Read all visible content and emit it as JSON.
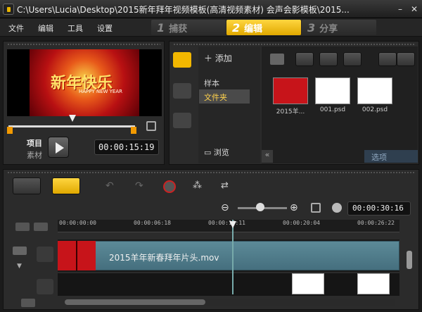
{
  "window": {
    "title": "C:\\Users\\Lucia\\Desktop\\2015新年拜年视频模板(高清视频素材) 会声会影模板\\2015...",
    "minimize": "–",
    "close": "✕"
  },
  "menu": [
    "文件",
    "编辑",
    "工具",
    "设置"
  ],
  "steps": [
    {
      "num": "1",
      "label": "捕获"
    },
    {
      "num": "2",
      "label": "编辑"
    },
    {
      "num": "3",
      "label": "分享"
    }
  ],
  "preview": {
    "title_text": "新年快乐",
    "sub_text": "HAPPY NEW YEAR",
    "project_label": "项目",
    "clip_label": "素材",
    "timecode": "00:00:15:19"
  },
  "library": {
    "add_label": "添加",
    "items": [
      "样本",
      "文件夹"
    ],
    "browse_label": "浏览",
    "thumbs": [
      {
        "caption": "2015羊..."
      },
      {
        "caption": "001.psd"
      },
      {
        "caption": "002.psd"
      }
    ],
    "options_label": "选项",
    "collapse_glyph": "«"
  },
  "timeline": {
    "timecode": "00:00:30:16",
    "ruler": [
      "00:00:00:00",
      "00:00:06:18",
      "00:00:13:11",
      "00:00:20:04",
      "00:00:26:22"
    ],
    "clip_name": "2015羊年新春拜年片头.mov"
  },
  "colors": {
    "accent": "#f2b700",
    "track_clip": "#56808e"
  }
}
